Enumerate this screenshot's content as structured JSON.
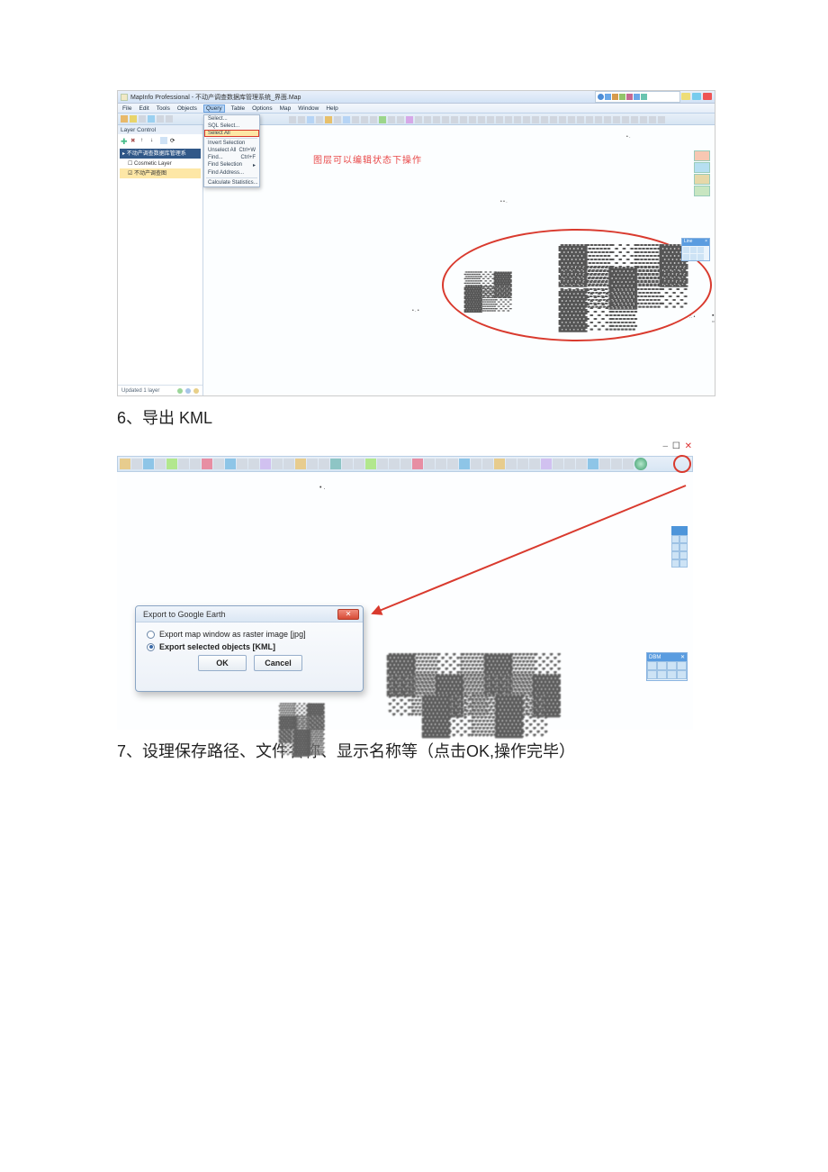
{
  "figure1": {
    "titlebar_text": "MapInfo Professional - 不动产调查数据库管理系统_界面.Map",
    "menus": [
      "File",
      "Edit",
      "Tools",
      "Objects",
      "Query",
      "Table",
      "Options",
      "Map",
      "Window",
      "Help"
    ],
    "active_menu_index": 4,
    "dropdown": [
      {
        "label": "Select...",
        "shortcut": ""
      },
      {
        "label": "SQL Select...",
        "shortcut": ""
      },
      {
        "label": "Select All",
        "shortcut": "",
        "highlight": true
      },
      {
        "label": "Invert Selection",
        "shortcut": ""
      },
      {
        "label": "Unselect All",
        "shortcut": "Ctrl+W"
      },
      {
        "label": "Find...",
        "shortcut": "Ctrl+F"
      },
      {
        "label": "Find Selection",
        "shortcut": "▸"
      },
      {
        "label": "Find Address...",
        "shortcut": ""
      },
      {
        "label": "Calculate Statistics...",
        "shortcut": ""
      }
    ],
    "layer_panel": {
      "title": "Layer Control",
      "items": [
        {
          "label": "不动产调查数据库管理系",
          "selected": true
        },
        {
          "label": "Cosmetic Layer",
          "selected": false
        },
        {
          "label": "不动产调查图",
          "selected2": true
        }
      ],
      "footer": "Updated 1 layer"
    },
    "annotation": "图层可以编辑状态下操作",
    "minipanel_title": "Line"
  },
  "step6_heading": "6、导出 KML",
  "figure2": {
    "win_controls": "– ✕",
    "dialog": {
      "title": "Export to Google Earth",
      "option1": "Export map window as raster image [jpg]",
      "option2": "Export selected objects [KML]",
      "ok": "OK",
      "cancel": "Cancel",
      "selected": 2
    },
    "dbm_title": "DBM",
    "dbm_x": "✕"
  },
  "step7_heading": "7、设理保存路径、文件名称、显示名称等（点击OK,操作完毕）"
}
